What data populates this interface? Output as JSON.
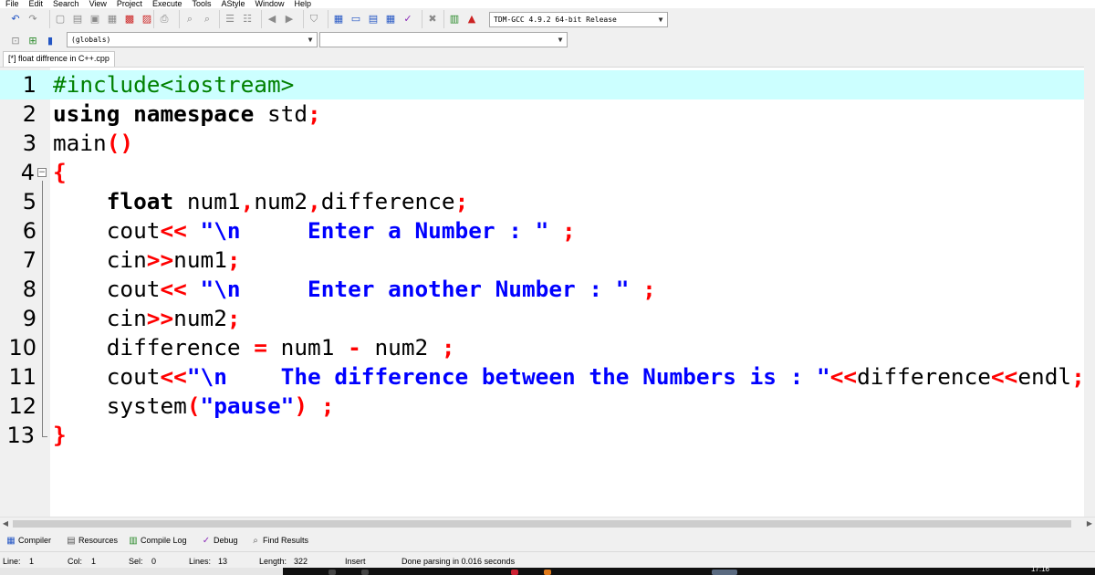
{
  "menu": [
    "File",
    "Edit",
    "Search",
    "View",
    "Project",
    "Execute",
    "Tools",
    "AStyle",
    "Window",
    "Help"
  ],
  "toolbar": {
    "compiler_select": "TDM-GCC 4.9.2 64-bit Release",
    "scope_select": "(globals)",
    "member_select": ""
  },
  "tab": {
    "label": "[*] float diffrence in C++.cpp"
  },
  "editor": {
    "active_line": 1,
    "lines": [
      {
        "num": "1",
        "text": "#include<iostream>"
      },
      {
        "num": "2",
        "text": "using namespace std;"
      },
      {
        "num": "3",
        "text": "main()"
      },
      {
        "num": "4",
        "text": "{"
      },
      {
        "num": "5",
        "text": "    float num1,num2,difference;"
      },
      {
        "num": "6",
        "text": "    cout<< \"\\n     Enter a Number : \" ;"
      },
      {
        "num": "7",
        "text": "    cin>>num1;"
      },
      {
        "num": "8",
        "text": "    cout<< \"\\n     Enter another Number : \" ;"
      },
      {
        "num": "9",
        "text": "    cin>>num2;"
      },
      {
        "num": "10",
        "text": "    difference = num1 - num2 ;"
      },
      {
        "num": "11",
        "text": "    cout<<\"\\n    The difference between the Numbers is : \"<<difference<<endl;"
      },
      {
        "num": "12",
        "text": "    system(\"pause\") ;"
      },
      {
        "num": "13",
        "text": "}"
      }
    ]
  },
  "panel_tabs": [
    {
      "label": "Compiler",
      "icon": "compiler-icon"
    },
    {
      "label": "Resources",
      "icon": "resources-icon"
    },
    {
      "label": "Compile Log",
      "icon": "compile-log-icon"
    },
    {
      "label": "Debug",
      "icon": "debug-icon"
    },
    {
      "label": "Find Results",
      "icon": "find-results-icon"
    }
  ],
  "status": {
    "line_label": "Line:",
    "line_value": "1",
    "col_label": "Col:",
    "col_value": "1",
    "sel_label": "Sel:",
    "sel_value": "0",
    "lines_label": "Lines:",
    "lines_value": "13",
    "length_label": "Length:",
    "length_value": "322",
    "mode": "Insert",
    "message": "Done parsing in 0.016 seconds"
  },
  "taskbar": {
    "clock": "17:16"
  },
  "colors": {
    "active_line": "#ccffff",
    "preprocessor": "#008000",
    "string": "#0000ff",
    "symbol": "#ff0000",
    "keyword": "#000000"
  }
}
